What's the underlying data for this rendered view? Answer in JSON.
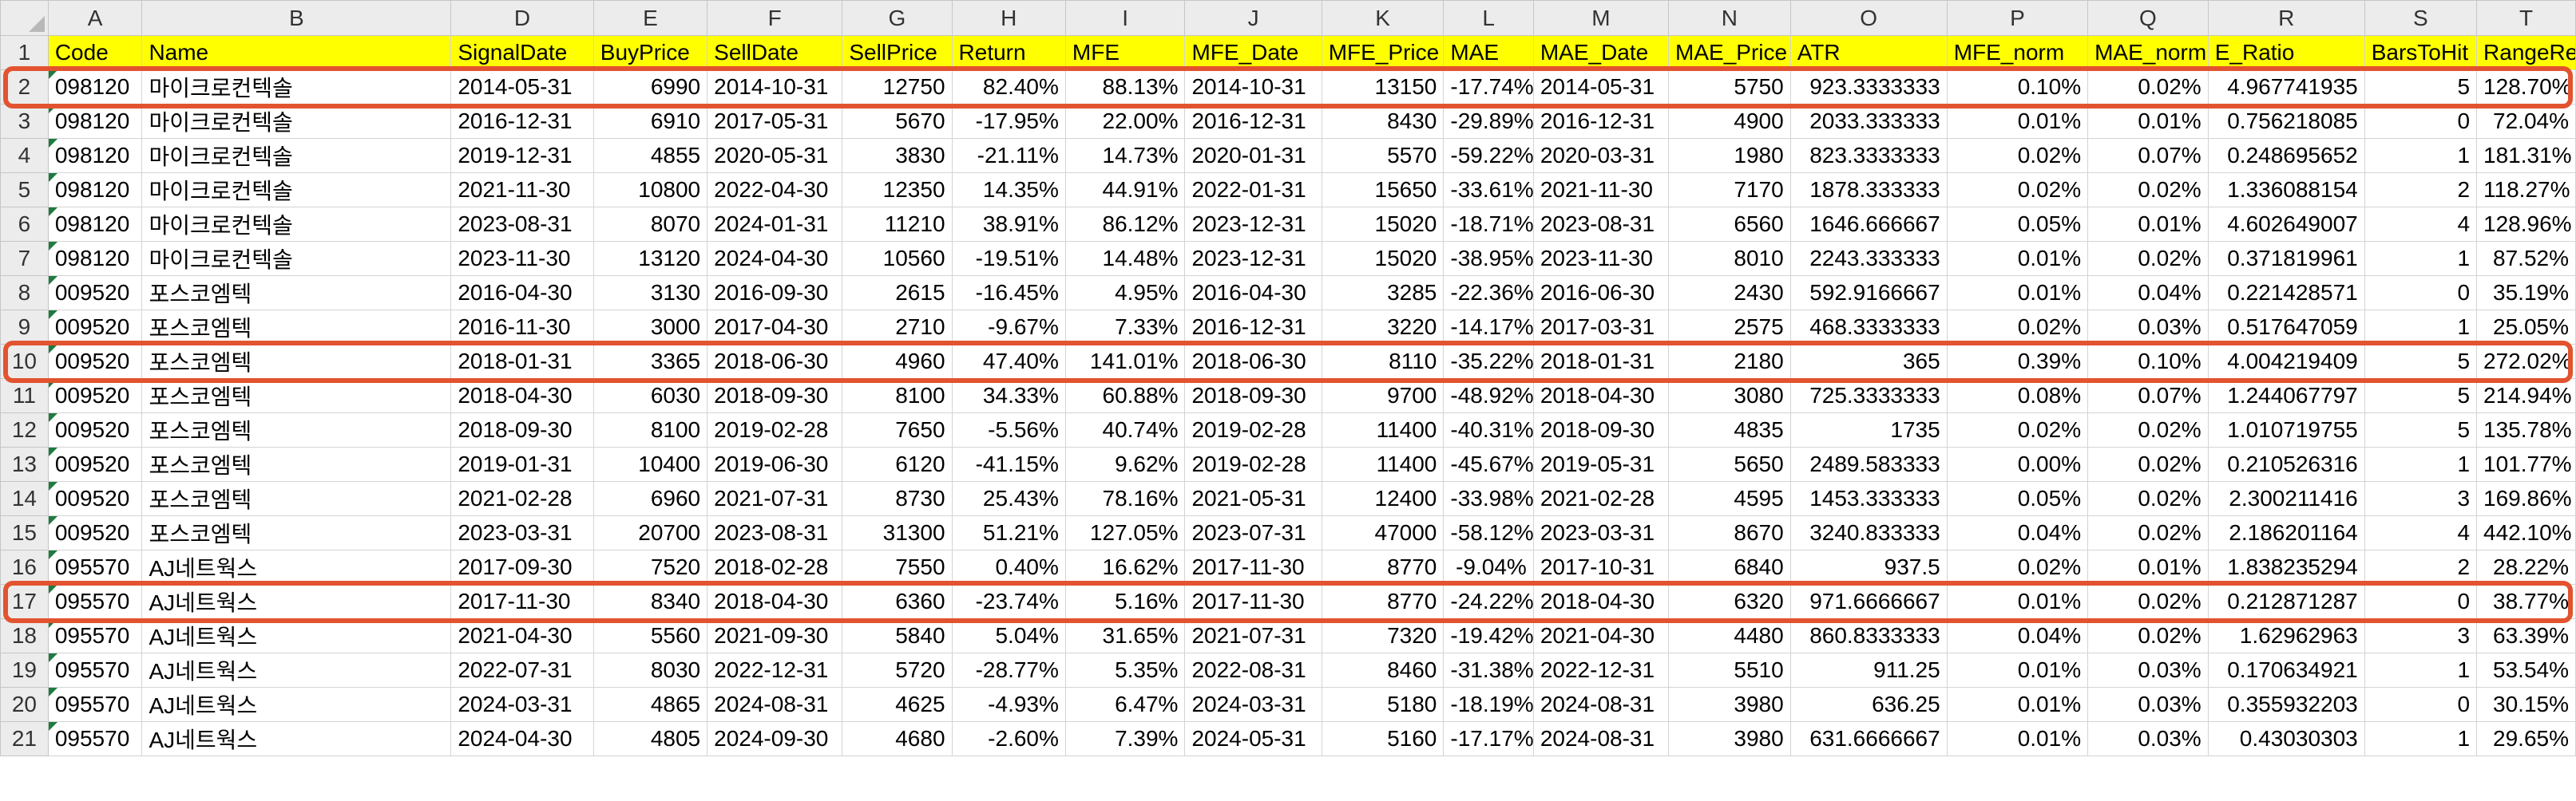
{
  "columns": [
    "A",
    "B",
    "D",
    "E",
    "F",
    "G",
    "H",
    "I",
    "J",
    "K",
    "L",
    "M",
    "N",
    "O",
    "P",
    "Q",
    "R",
    "S",
    "T"
  ],
  "header": [
    "Code",
    "Name",
    "SignalDate",
    "BuyPrice",
    "SellDate",
    "SellPrice",
    "Return",
    "MFE",
    "MFE_Date",
    "MFE_Price",
    "MAE",
    "MAE_Date",
    "MAE_Price",
    "ATR",
    "MFE_norm",
    "MAE_norm",
    "E_Ratio",
    "BarsToHit",
    "RangeReturn"
  ],
  "rows": [
    {
      "n": "2",
      "c": [
        "098120",
        "마이크로컨텍솔",
        "2014-05-31",
        "6990",
        "2014-10-31",
        "12750",
        "82.40%",
        "88.13%",
        "2014-10-31",
        "13150",
        "-17.74%",
        "2014-05-31",
        "5750",
        "923.3333333",
        "0.10%",
        "0.02%",
        "4.967741935",
        "5",
        "128.70%"
      ]
    },
    {
      "n": "3",
      "c": [
        "098120",
        "마이크로컨텍솔",
        "2016-12-31",
        "6910",
        "2017-05-31",
        "5670",
        "-17.95%",
        "22.00%",
        "2016-12-31",
        "8430",
        "-29.89%",
        "2016-12-31",
        "4900",
        "2033.333333",
        "0.01%",
        "0.01%",
        "0.756218085",
        "0",
        "72.04%"
      ]
    },
    {
      "n": "4",
      "c": [
        "098120",
        "마이크로컨텍솔",
        "2019-12-31",
        "4855",
        "2020-05-31",
        "3830",
        "-21.11%",
        "14.73%",
        "2020-01-31",
        "5570",
        "-59.22%",
        "2020-03-31",
        "1980",
        "823.3333333",
        "0.02%",
        "0.07%",
        "0.248695652",
        "1",
        "181.31%"
      ]
    },
    {
      "n": "5",
      "c": [
        "098120",
        "마이크로컨텍솔",
        "2021-11-30",
        "10800",
        "2022-04-30",
        "12350",
        "14.35%",
        "44.91%",
        "2022-01-31",
        "15650",
        "-33.61%",
        "2021-11-30",
        "7170",
        "1878.333333",
        "0.02%",
        "0.02%",
        "1.336088154",
        "2",
        "118.27%"
      ]
    },
    {
      "n": "6",
      "c": [
        "098120",
        "마이크로컨텍솔",
        "2023-08-31",
        "8070",
        "2024-01-31",
        "11210",
        "38.91%",
        "86.12%",
        "2023-12-31",
        "15020",
        "-18.71%",
        "2023-08-31",
        "6560",
        "1646.666667",
        "0.05%",
        "0.01%",
        "4.602649007",
        "4",
        "128.96%"
      ]
    },
    {
      "n": "7",
      "c": [
        "098120",
        "마이크로컨텍솔",
        "2023-11-30",
        "13120",
        "2024-04-30",
        "10560",
        "-19.51%",
        "14.48%",
        "2023-12-31",
        "15020",
        "-38.95%",
        "2023-11-30",
        "8010",
        "2243.333333",
        "0.01%",
        "0.02%",
        "0.371819961",
        "1",
        "87.52%"
      ]
    },
    {
      "n": "8",
      "c": [
        "009520",
        "포스코엠텍",
        "2016-04-30",
        "3130",
        "2016-09-30",
        "2615",
        "-16.45%",
        "4.95%",
        "2016-04-30",
        "3285",
        "-22.36%",
        "2016-06-30",
        "2430",
        "592.9166667",
        "0.01%",
        "0.04%",
        "0.221428571",
        "0",
        "35.19%"
      ]
    },
    {
      "n": "9",
      "c": [
        "009520",
        "포스코엠텍",
        "2016-11-30",
        "3000",
        "2017-04-30",
        "2710",
        "-9.67%",
        "7.33%",
        "2016-12-31",
        "3220",
        "-14.17%",
        "2017-03-31",
        "2575",
        "468.3333333",
        "0.02%",
        "0.03%",
        "0.517647059",
        "1",
        "25.05%"
      ]
    },
    {
      "n": "10",
      "c": [
        "009520",
        "포스코엠텍",
        "2018-01-31",
        "3365",
        "2018-06-30",
        "4960",
        "47.40%",
        "141.01%",
        "2018-06-30",
        "8110",
        "-35.22%",
        "2018-01-31",
        "2180",
        "365",
        "0.39%",
        "0.10%",
        "4.004219409",
        "5",
        "272.02%"
      ]
    },
    {
      "n": "11",
      "c": [
        "009520",
        "포스코엠텍",
        "2018-04-30",
        "6030",
        "2018-09-30",
        "8100",
        "34.33%",
        "60.88%",
        "2018-09-30",
        "9700",
        "-48.92%",
        "2018-04-30",
        "3080",
        "725.3333333",
        "0.08%",
        "0.07%",
        "1.244067797",
        "5",
        "214.94%"
      ]
    },
    {
      "n": "12",
      "c": [
        "009520",
        "포스코엠텍",
        "2018-09-30",
        "8100",
        "2019-02-28",
        "7650",
        "-5.56%",
        "40.74%",
        "2019-02-28",
        "11400",
        "-40.31%",
        "2018-09-30",
        "4835",
        "1735",
        "0.02%",
        "0.02%",
        "1.010719755",
        "5",
        "135.78%"
      ]
    },
    {
      "n": "13",
      "c": [
        "009520",
        "포스코엠텍",
        "2019-01-31",
        "10400",
        "2019-06-30",
        "6120",
        "-41.15%",
        "9.62%",
        "2019-02-28",
        "11400",
        "-45.67%",
        "2019-05-31",
        "5650",
        "2489.583333",
        "0.00%",
        "0.02%",
        "0.210526316",
        "1",
        "101.77%"
      ]
    },
    {
      "n": "14",
      "c": [
        "009520",
        "포스코엠텍",
        "2021-02-28",
        "6960",
        "2021-07-31",
        "8730",
        "25.43%",
        "78.16%",
        "2021-05-31",
        "12400",
        "-33.98%",
        "2021-02-28",
        "4595",
        "1453.333333",
        "0.05%",
        "0.02%",
        "2.300211416",
        "3",
        "169.86%"
      ]
    },
    {
      "n": "15",
      "c": [
        "009520",
        "포스코엠텍",
        "2023-03-31",
        "20700",
        "2023-08-31",
        "31300",
        "51.21%",
        "127.05%",
        "2023-07-31",
        "47000",
        "-58.12%",
        "2023-03-31",
        "8670",
        "3240.833333",
        "0.04%",
        "0.02%",
        "2.186201164",
        "4",
        "442.10%"
      ]
    },
    {
      "n": "16",
      "c": [
        "095570",
        "AJ네트웍스",
        "2017-09-30",
        "7520",
        "2018-02-28",
        "7550",
        "0.40%",
        "16.62%",
        "2017-11-30",
        "8770",
        "-9.04%",
        "2017-10-31",
        "6840",
        "937.5",
        "0.02%",
        "0.01%",
        "1.838235294",
        "2",
        "28.22%"
      ]
    },
    {
      "n": "17",
      "c": [
        "095570",
        "AJ네트웍스",
        "2017-11-30",
        "8340",
        "2018-04-30",
        "6360",
        "-23.74%",
        "5.16%",
        "2017-11-30",
        "8770",
        "-24.22%",
        "2018-04-30",
        "6320",
        "971.6666667",
        "0.01%",
        "0.02%",
        "0.212871287",
        "0",
        "38.77%"
      ]
    },
    {
      "n": "18",
      "c": [
        "095570",
        "AJ네트웍스",
        "2021-04-30",
        "5560",
        "2021-09-30",
        "5840",
        "5.04%",
        "31.65%",
        "2021-07-31",
        "7320",
        "-19.42%",
        "2021-04-30",
        "4480",
        "860.8333333",
        "0.04%",
        "0.02%",
        "1.62962963",
        "3",
        "63.39%"
      ]
    },
    {
      "n": "19",
      "c": [
        "095570",
        "AJ네트웍스",
        "2022-07-31",
        "8030",
        "2022-12-31",
        "5720",
        "-28.77%",
        "5.35%",
        "2022-08-31",
        "8460",
        "-31.38%",
        "2022-12-31",
        "5510",
        "911.25",
        "0.01%",
        "0.03%",
        "0.170634921",
        "1",
        "53.54%"
      ]
    },
    {
      "n": "20",
      "c": [
        "095570",
        "AJ네트웍스",
        "2024-03-31",
        "4865",
        "2024-08-31",
        "4625",
        "-4.93%",
        "6.47%",
        "2024-03-31",
        "5180",
        "-18.19%",
        "2024-08-31",
        "3980",
        "636.25",
        "0.01%",
        "0.03%",
        "0.355932203",
        "0",
        "30.15%"
      ]
    },
    {
      "n": "21",
      "c": [
        "095570",
        "AJ네트웍스",
        "2024-04-30",
        "4805",
        "2024-09-30",
        "4680",
        "-2.60%",
        "7.39%",
        "2024-05-31",
        "5160",
        "-17.17%",
        "2024-08-31",
        "3980",
        "631.6666667",
        "0.01%",
        "0.03%",
        "0.43030303",
        "1",
        "29.65%"
      ]
    }
  ],
  "highlighted_rows": [
    "2",
    "10",
    "17"
  ],
  "colors": {
    "header_fill": "#ffff00",
    "highlight": "#e2532f",
    "grid": "#d4d4d4",
    "heading_bg": "#ececec"
  }
}
